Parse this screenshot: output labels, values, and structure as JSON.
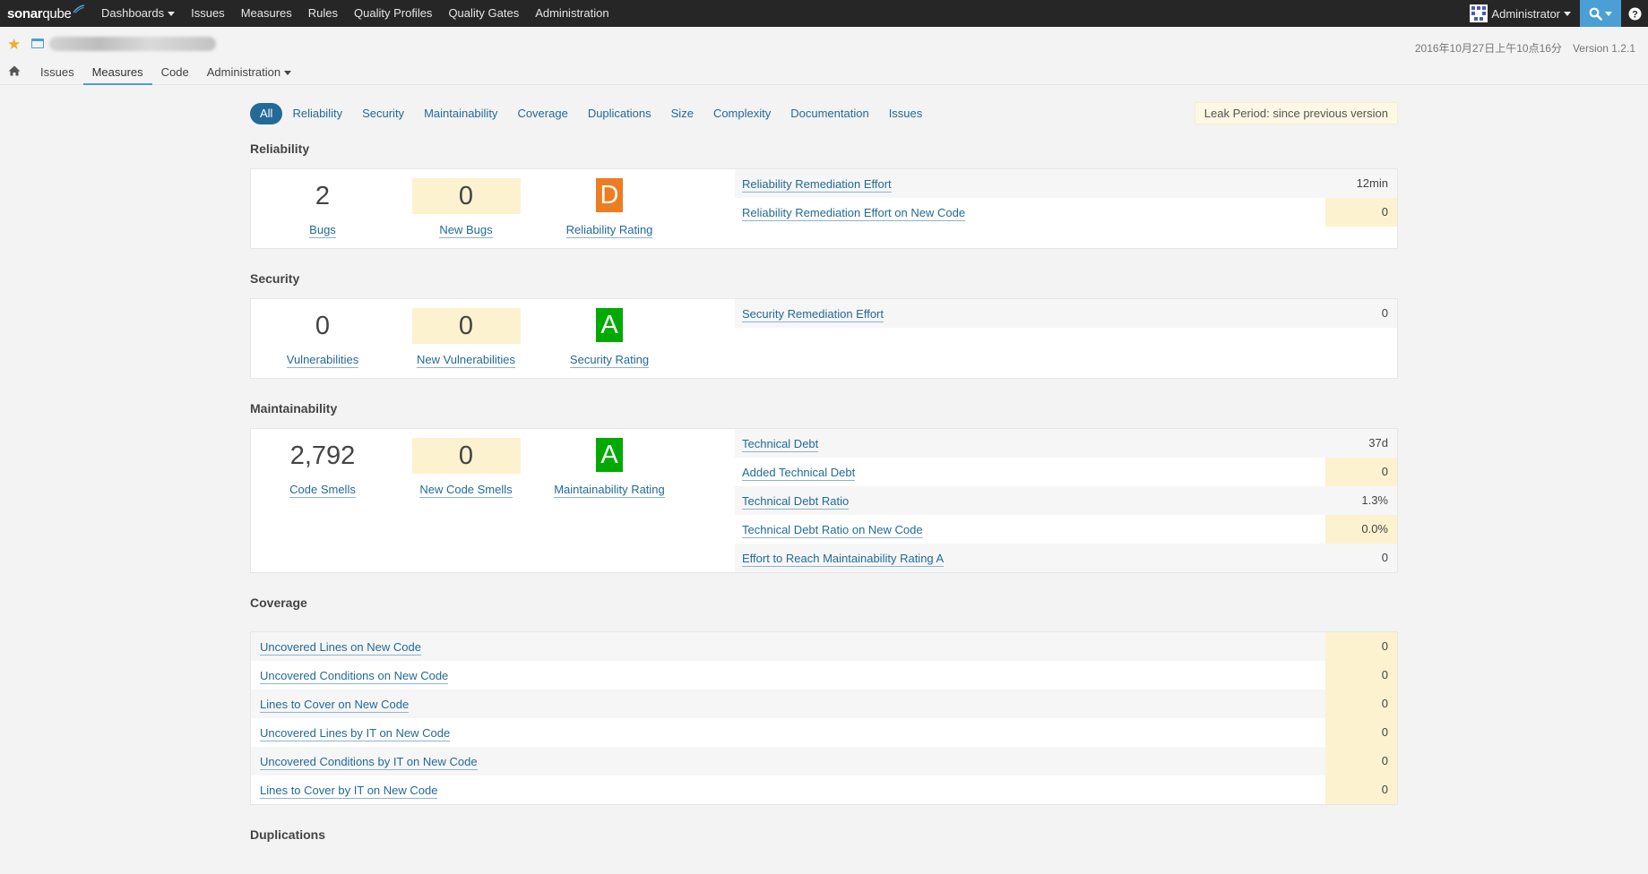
{
  "topbar": {
    "logo": {
      "sonar": "sonar",
      "qube": "qube"
    },
    "nav": [
      {
        "label": "Dashboards",
        "dropdown": true
      },
      {
        "label": "Issues"
      },
      {
        "label": "Measures"
      },
      {
        "label": "Rules"
      },
      {
        "label": "Quality Profiles"
      },
      {
        "label": "Quality Gates"
      },
      {
        "label": "Administration"
      }
    ],
    "user": "Administrator",
    "help": "?"
  },
  "context": {
    "date": "2016年10月27日上午10点16分",
    "version": "Version 1.2.1",
    "tabs": [
      "Issues",
      "Measures",
      "Code",
      "Administration"
    ]
  },
  "filters": {
    "items": [
      "All",
      "Reliability",
      "Security",
      "Maintainability",
      "Coverage",
      "Duplications",
      "Size",
      "Complexity",
      "Documentation",
      "Issues"
    ],
    "leak_period": "Leak Period: since previous version"
  },
  "reliability": {
    "title": "Reliability",
    "big": [
      {
        "value": "2",
        "label": "Bugs"
      },
      {
        "value": "0",
        "label": "New Bugs"
      },
      {
        "value": "D",
        "label": "Reliability Rating"
      }
    ],
    "rows": [
      {
        "label": "Reliability Remediation Effort",
        "value": "12min",
        "leak": false
      },
      {
        "label": "Reliability Remediation Effort on New Code",
        "value": "0",
        "leak": true
      }
    ]
  },
  "security": {
    "title": "Security",
    "big": [
      {
        "value": "0",
        "label": "Vulnerabilities"
      },
      {
        "value": "0",
        "label": "New Vulnerabilities"
      },
      {
        "value": "A",
        "label": "Security Rating"
      }
    ],
    "rows": [
      {
        "label": "Security Remediation Effort",
        "value": "0",
        "leak": false
      }
    ]
  },
  "maintainability": {
    "title": "Maintainability",
    "big": [
      {
        "value": "2,792",
        "label": "Code Smells"
      },
      {
        "value": "0",
        "label": "New Code Smells"
      },
      {
        "value": "A",
        "label": "Maintainability Rating"
      }
    ],
    "rows": [
      {
        "label": "Technical Debt",
        "value": "37d",
        "leak": false
      },
      {
        "label": "Added Technical Debt",
        "value": "0",
        "leak": true
      },
      {
        "label": "Technical Debt Ratio",
        "value": "1.3%",
        "leak": false
      },
      {
        "label": "Technical Debt Ratio on New Code",
        "value": "0.0%",
        "leak": true
      },
      {
        "label": "Effort to Reach Maintainability Rating A",
        "value": "0",
        "leak": false
      }
    ]
  },
  "coverage": {
    "title": "Coverage",
    "rows": [
      {
        "label": "Uncovered Lines on New Code",
        "value": "0"
      },
      {
        "label": "Uncovered Conditions on New Code",
        "value": "0"
      },
      {
        "label": "Lines to Cover on New Code",
        "value": "0"
      },
      {
        "label": "Uncovered Lines by IT on New Code",
        "value": "0"
      },
      {
        "label": "Uncovered Conditions by IT on New Code",
        "value": "0"
      },
      {
        "label": "Lines to Cover by IT on New Code",
        "value": "0"
      }
    ]
  },
  "duplications": {
    "title": "Duplications"
  }
}
